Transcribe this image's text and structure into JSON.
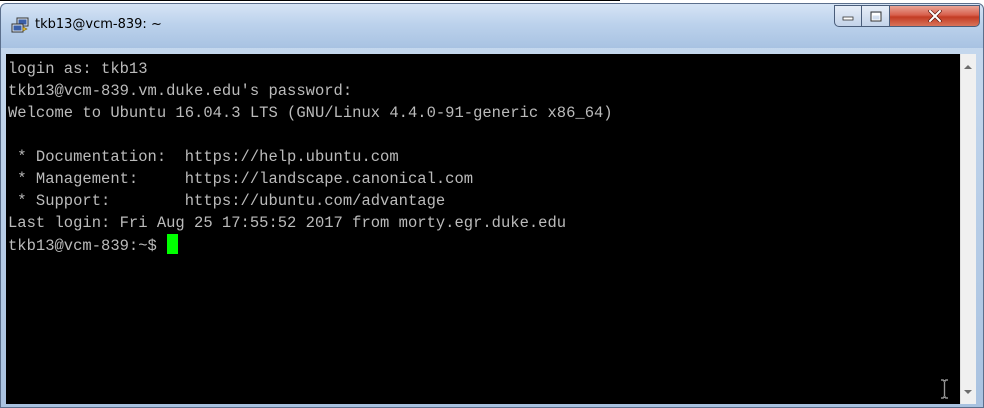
{
  "window": {
    "title": "tkb13@vcm-839: ~",
    "app_icon": "putty-icon",
    "controls": [
      "minimize-icon",
      "maximize-icon",
      "close-icon"
    ]
  },
  "terminal": {
    "lines": [
      "login as: tkb13",
      "tkb13@vcm-839.vm.duke.edu's password:",
      "Welcome to Ubuntu 16.04.3 LTS (GNU/Linux 4.4.0-91-generic x86_64)",
      "",
      " * Documentation:  https://help.ubuntu.com",
      " * Management:     https://landscape.canonical.com",
      " * Support:        https://ubuntu.com/advantage",
      "Last login: Fri Aug 25 17:55:52 2017 from morty.egr.duke.edu"
    ],
    "prompt": "tkb13@vcm-839:~$ ",
    "cursor_color": "#00ff00",
    "text_color": "#bbbbbb",
    "background_color": "#000000"
  },
  "scrollbar": {
    "up_icon": "scroll-up-arrow-icon",
    "down_icon": "scroll-down-arrow-icon"
  },
  "mouse_cursor": "text-ibeam-icon"
}
